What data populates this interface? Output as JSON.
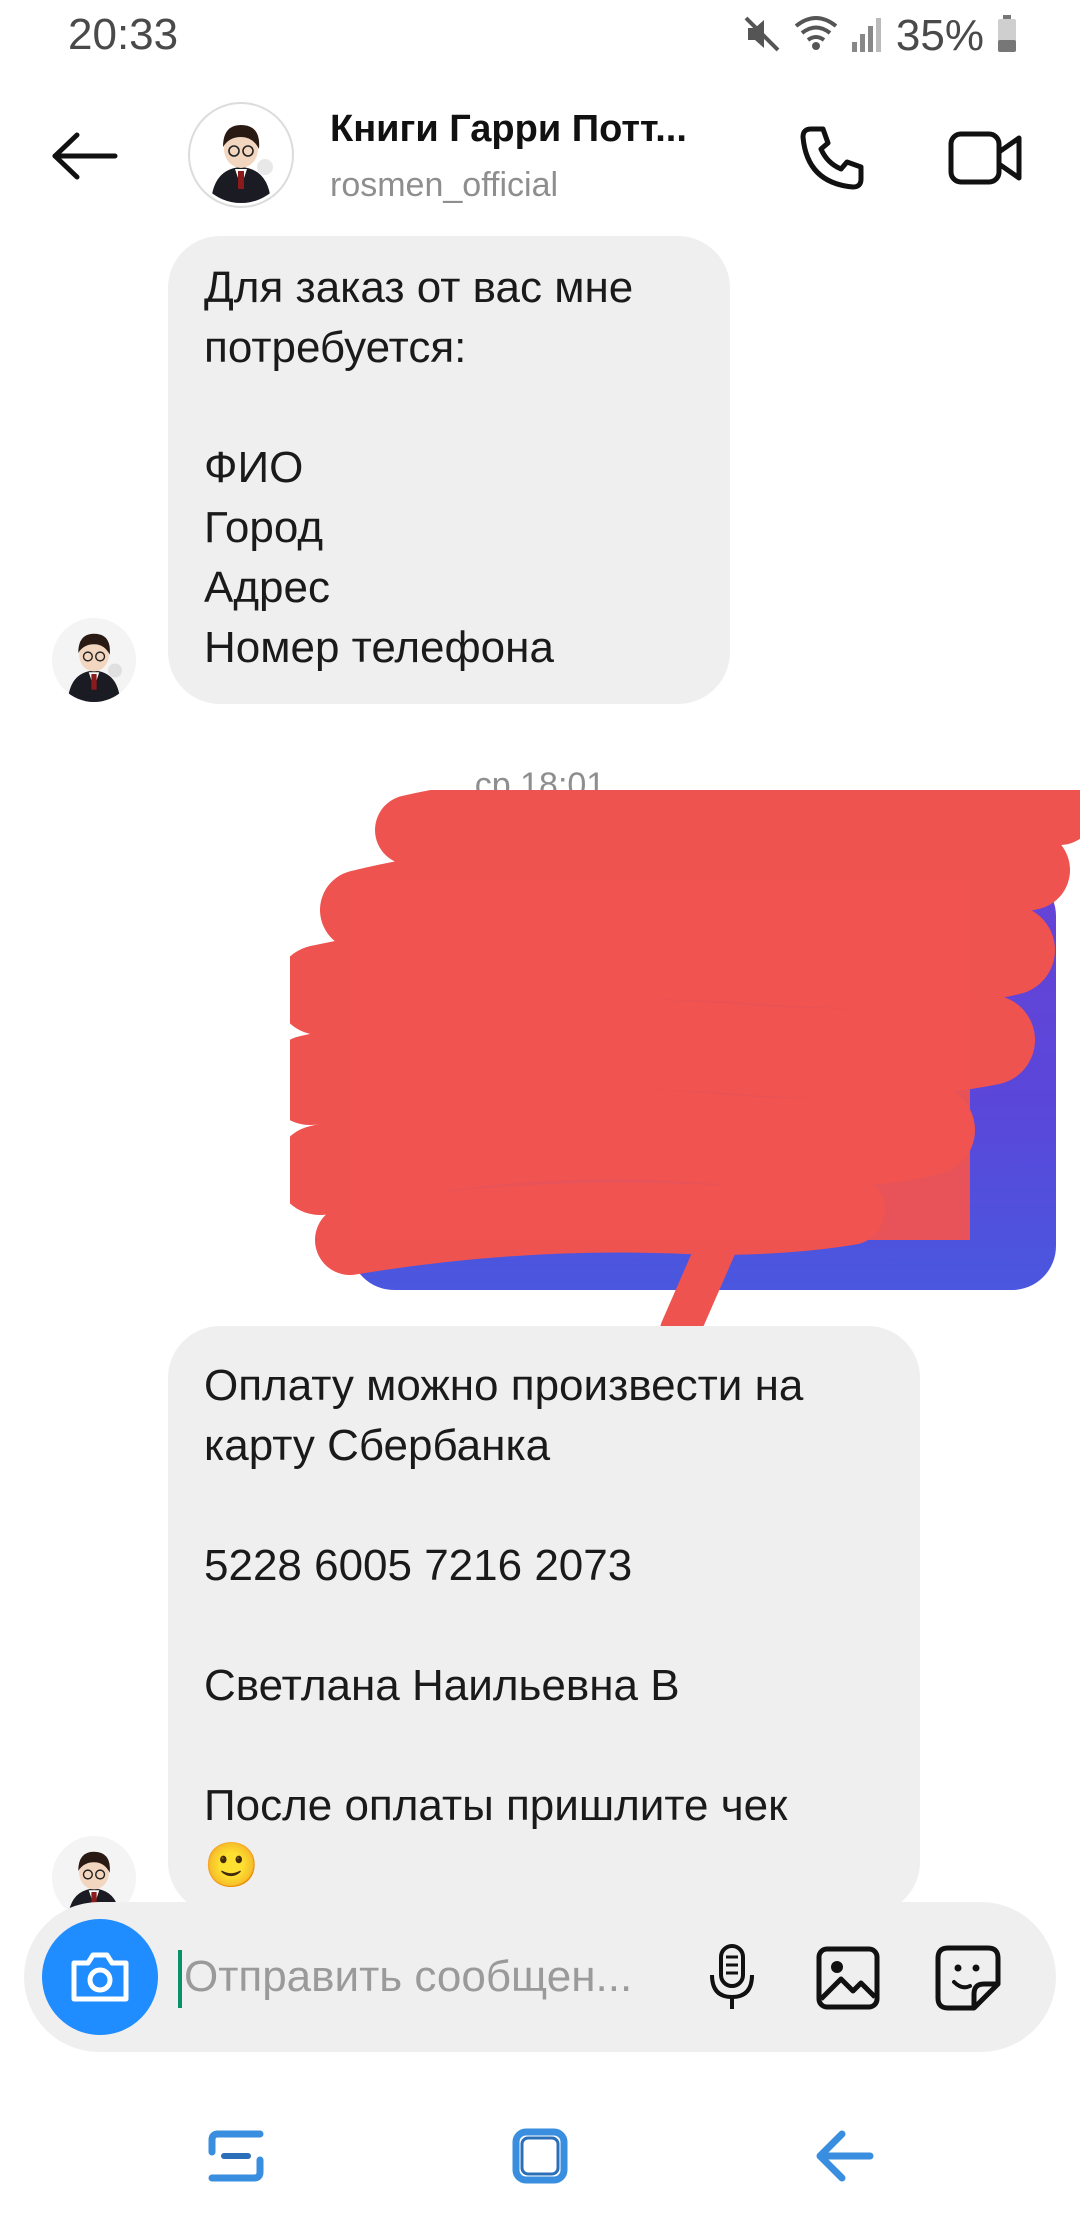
{
  "status_bar": {
    "time": "20:33",
    "battery": "35%"
  },
  "header": {
    "title": "Книги Гарри Потт...",
    "username": "rosmen_official"
  },
  "messages": {
    "m1": {
      "lines": [
        "Для заказ от вас мне",
        "потребуется:",
        "",
        "ФИО",
        "Город",
        "Адрес",
        "Номер телефона"
      ]
    },
    "date_separator": "ср 18:01",
    "m3": {
      "lines": [
        "Оплату можно произвести на",
        "карту Сбербанка",
        "",
        "5228 6005 7216 2073",
        "",
        "Светлана Наильевна В",
        "",
        "После оплаты пришлите чек"
      ],
      "emoji": "🙂"
    }
  },
  "composer": {
    "placeholder": "Отправить сообщен..."
  },
  "colors": {
    "accent_blue": "#1f8cff",
    "bubble_gray": "#efefef",
    "image_gradient_top": "#6642d6",
    "image_gradient_bottom": "#4a57de",
    "redaction_red": "#ef5350",
    "nav_icon_blue": "#3a8ee0"
  },
  "icons": {
    "back": "arrow-left-icon",
    "call": "phone-icon",
    "video": "video-camera-icon",
    "camera": "camera-icon",
    "mic": "microphone-icon",
    "gallery": "image-icon",
    "sticker": "sticker-icon",
    "nav_recents": "recents-icon",
    "nav_home": "home-icon",
    "nav_back": "nav-back-icon"
  }
}
